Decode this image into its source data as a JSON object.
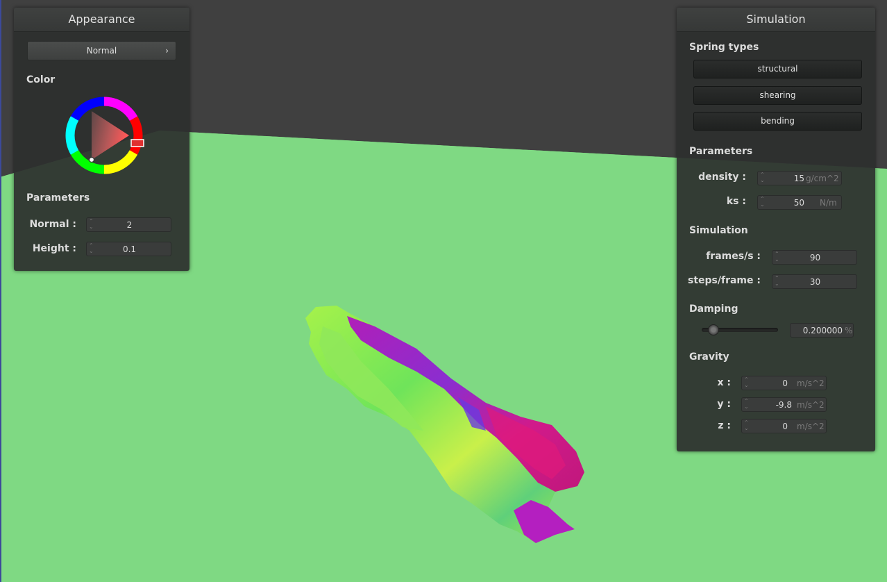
{
  "appearance": {
    "title": "Appearance",
    "shader_dropdown": "Normal",
    "color_label": "Color",
    "parameters_label": "Parameters",
    "normal_label": "Normal :",
    "normal_value": "2",
    "height_label": "Height :",
    "height_value": "0.1"
  },
  "simulation": {
    "title": "Simulation",
    "spring_types_label": "Spring types",
    "spring_buttons": [
      "structural",
      "shearing",
      "bending"
    ],
    "parameters_label": "Parameters",
    "density_label": "density :",
    "density_value": "15",
    "density_unit": "g/cm^2",
    "ks_label": "ks :",
    "ks_value": "50",
    "ks_unit": "N/m",
    "simulation_label": "Simulation",
    "fps_label": "frames/s :",
    "fps_value": "90",
    "steps_label": "steps/frame :",
    "steps_value": "30",
    "damping_label": "Damping",
    "damping_value": "0.200000",
    "damping_unit": "%",
    "damping_slider_fraction": 0.1,
    "gravity_label": "Gravity",
    "gx_label": "x :",
    "gx_value": "0",
    "gy_label": "y :",
    "gy_value": "-9.8",
    "gz_label": "z :",
    "gz_value": "0",
    "gravity_unit": "m/s^2"
  },
  "colors": {
    "floor": "#7fd983",
    "background": "#404040",
    "panel": "#2d2f2e",
    "selected_color": "#e03030"
  }
}
